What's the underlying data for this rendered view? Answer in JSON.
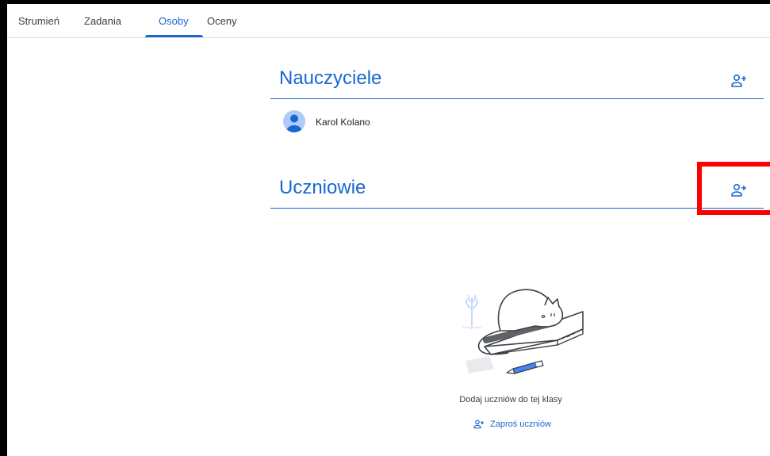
{
  "tabs": [
    {
      "label": "Strumień"
    },
    {
      "label": "Zadania"
    },
    {
      "label": "Osoby"
    },
    {
      "label": "Oceny"
    }
  ],
  "active_tab": "Osoby",
  "teachers": {
    "title": "Nauczyciele",
    "add_icon": "person-add-icon",
    "list": [
      {
        "name": "Karol Kolano"
      }
    ]
  },
  "students": {
    "title": "Uczniowie",
    "add_icon": "person-add-icon",
    "empty_message": "Dodaj uczniów do tej klasy",
    "invite_label": "Zaproś uczniów",
    "invite_icon": "person-add-icon"
  },
  "colors": {
    "accent": "#1967d2",
    "highlight": "#ff0000",
    "avatar": "#aecbfa"
  }
}
